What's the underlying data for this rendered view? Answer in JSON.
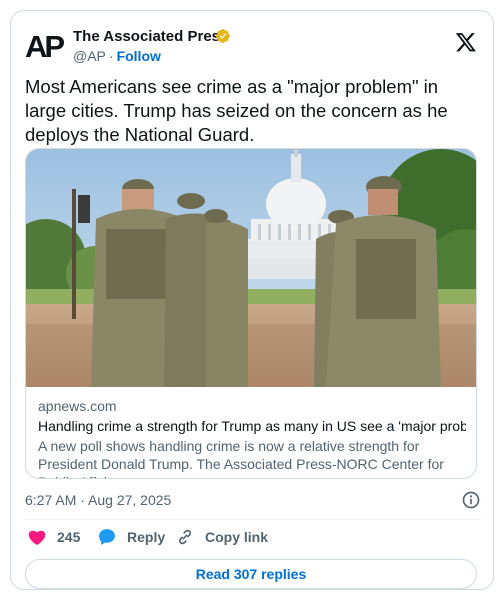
{
  "author": {
    "logo_text": "AP",
    "name": "The Associated Press",
    "handle": "@AP",
    "separator": "·",
    "follow_label": "Follow",
    "verified_color": "#e2b719"
  },
  "tweet": {
    "text": "Most Americans see crime as a \"major problem\" in large cities. Trump has seized on the concern as he deploys the National Guard."
  },
  "link_card": {
    "image_icon": "photo-soldiers-capitol",
    "domain": "apnews.com",
    "headline": "Handling crime a strength for Trump as many in US see a 'major proble...",
    "description": "A new poll shows handling crime is now a relative strength for President Donald Trump. The Associated Press-NORC Center for Public Affairs ..."
  },
  "meta": {
    "timestamp": "6:27 AM · Aug 27, 2025"
  },
  "actions": {
    "like_count": "245",
    "reply_label": "Reply",
    "copy_label": "Copy link",
    "like_color": "#f91880",
    "reply_color": "#1d9bf0"
  },
  "footer": {
    "read_replies_label": "Read 307 replies"
  },
  "colors": {
    "link_blue": "#006fd6",
    "muted": "#536471",
    "border": "#cfd9de"
  }
}
